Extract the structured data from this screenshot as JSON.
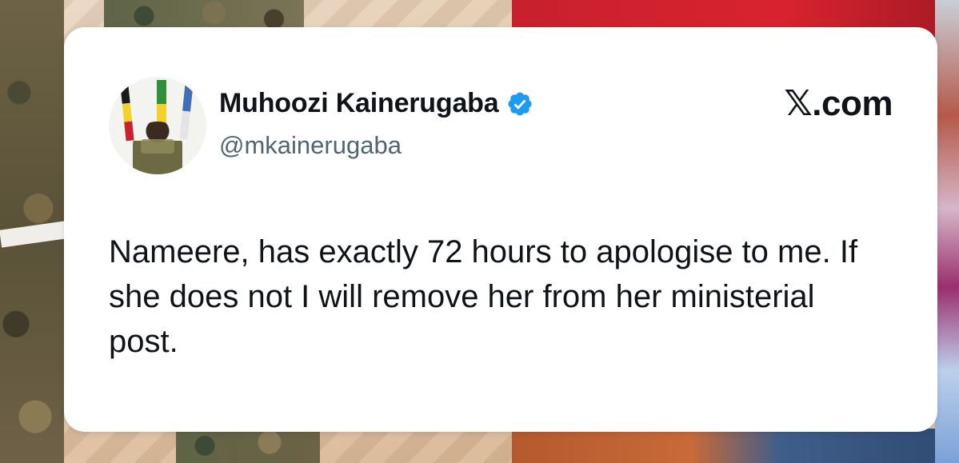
{
  "tweet": {
    "author_name": "Muhoozi Kainerugaba",
    "handle": "@mkainerugaba",
    "site_label": "𝕏.com",
    "text": "Nameere, has exactly 72 hours to apologise to me. If she does not I will remove her from her ministerial post.",
    "verified": true,
    "verified_icon": "verified-badge-icon",
    "verified_color": "#1d9bf0"
  },
  "colors": {
    "card_background": "#ffffff",
    "text_primary": "#0f1419",
    "text_secondary": "#536471"
  }
}
